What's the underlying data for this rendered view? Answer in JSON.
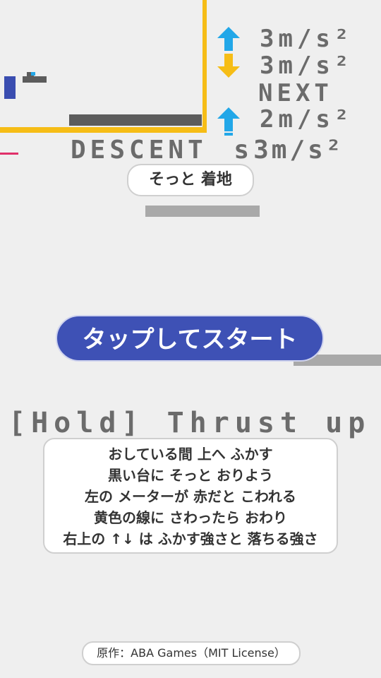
{
  "hud": {
    "rows": [
      {
        "icon": "up-arrow-icon",
        "color": "#22a7e8",
        "value": "3m/s²"
      },
      {
        "icon": "down-arrow-icon",
        "color": "#f6bd16",
        "value": "3m/s²"
      },
      {
        "icon": "up-arrow-icon",
        "color": "#22a7e8",
        "value": "2m/s²"
      }
    ],
    "next_label": "NEXT",
    "next_down_value": "3m/s²",
    "descent_label": "DESCENT",
    "descent_value": "s"
  },
  "hint": "そっと 着地",
  "start_button": "タップしてスタート",
  "hold_label": "[Hold] Thrust up",
  "instructions": [
    "おしている間 上へ ふかす",
    "黒い台に そっと おりよう",
    "左の メーターが 赤だと こわれる",
    "黄色の線に さわったら おわり",
    "右上の ↑↓ は ふかす強さと 落ちる強さ"
  ],
  "credit": "原作：ABA Games（MIT License）",
  "colors": {
    "background": "#efefef",
    "wall": "#f6bd16",
    "pad": "#5c5c5c",
    "meter": "#3a4db0",
    "danger": "#e0306a",
    "up_arrow": "#22a7e8",
    "down_arrow": "#f6bd16",
    "button": "#3e51b5"
  }
}
